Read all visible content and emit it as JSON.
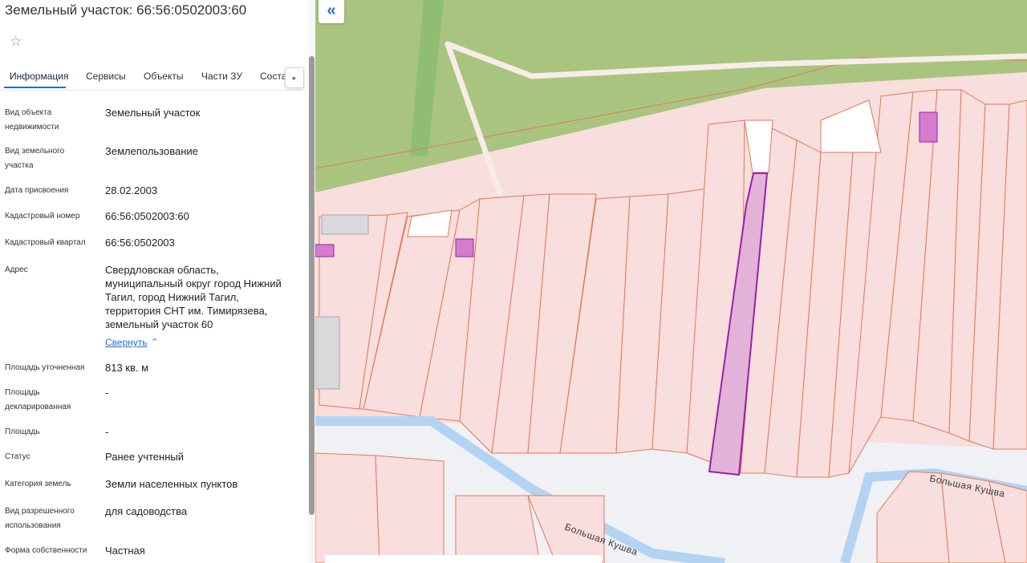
{
  "panel": {
    "title": "Земельный участок: 66:56:0502003:60",
    "tabs": [
      "Информация",
      "Сервисы",
      "Объекты",
      "Части ЗУ",
      "Соста"
    ],
    "tab_scroll_glyph": "▸",
    "favorite_icon": "☆",
    "collapse_link": "Свернуть",
    "collapse_chevron": "⌃",
    "fields": {
      "object_type": {
        "label": "Вид объекта недвижимости",
        "value": "Земельный участок"
      },
      "land_type": {
        "label": "Вид земельного участка",
        "value": "Землепользование"
      },
      "assign_date": {
        "label": "Дата присвоения",
        "value": "28.02.2003"
      },
      "cadastral_number": {
        "label": "Кадастровый номер",
        "value": "66:56:0502003:60"
      },
      "cadastral_quarter": {
        "label": "Кадастровый квартал",
        "value": "66:56:0502003"
      },
      "address": {
        "label": "Адрес",
        "lines": [
          "Свердловская область,",
          "муниципальный округ город Нижний",
          "Тагил, город Нижний Тагил,",
          "территория СНТ им. Тимирязева,",
          "земельный участок 60"
        ]
      },
      "area_refined": {
        "label": "Площадь уточненная",
        "value": "813 кв. м"
      },
      "area_declared": {
        "label": "Площадь декларированная",
        "value": "-"
      },
      "area": {
        "label": "Площадь",
        "value": "-"
      },
      "status": {
        "label": "Статус",
        "value": "Ранее учтенный"
      },
      "land_category": {
        "label": "Категория земель",
        "value": "Земли населенных пунктов"
      },
      "permitted_use": {
        "label": "Вид разрешенного использования",
        "value": "для садоводства"
      },
      "ownership": {
        "label": "Форма собственности",
        "value": "Частная"
      }
    }
  },
  "map": {
    "collapse_icon": "«",
    "river_labels": [
      "Большая Кушва",
      "Большая Кушва"
    ],
    "colors": {
      "forest": "#a9c47f",
      "parcel_fill": "#f8dedd",
      "parcel_stroke": "#e07a55",
      "selected_stroke": "#9b1fa8",
      "selected_fill": "#e2b2d8",
      "river": "#b3d3f3",
      "road": "#f7ecea"
    }
  }
}
